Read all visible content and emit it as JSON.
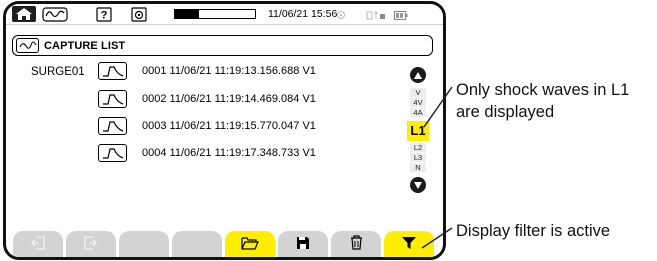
{
  "status_bar": {
    "tabs": [
      {
        "icon": "home-icon",
        "selected": true
      },
      {
        "icon": "waveform-icon",
        "selected": false
      },
      {
        "icon": "help-icon",
        "selected": false
      },
      {
        "icon": "camera-icon",
        "selected": false
      }
    ],
    "storage_fill": 0.3,
    "datetime": "11/06/21 15:56",
    "indicators": [
      "sync-icon",
      "network-icon",
      "battery-icon"
    ]
  },
  "title": {
    "icon": "waveform-icon",
    "text": "CAPTURE LIST"
  },
  "capture_list": {
    "group_label": "SURGE01",
    "rows": [
      {
        "icon": "shock-wave-icon",
        "text": "0001  11/06/21  11:19:13.156.688  V1"
      },
      {
        "icon": "shock-wave-icon",
        "text": "0002  11/06/21  11:19:14.469.084  V1"
      },
      {
        "icon": "shock-wave-icon",
        "text": "0003  11/06/21  11:19:15.770.047  V1"
      },
      {
        "icon": "shock-wave-icon",
        "text": "0004  11/06/21  11:19:17.348.733  V1"
      }
    ]
  },
  "phase_selector": {
    "up_icon": "arrow-up-icon",
    "down_icon": "arrow-down-icon",
    "upper_phases": [
      "V",
      "4V",
      "4A"
    ],
    "selected": "L1",
    "lower_phases": [
      "L2",
      "L3",
      "N"
    ]
  },
  "bottom_bar": {
    "buttons": [
      {
        "icon": "previous-icon",
        "state": "disabled"
      },
      {
        "icon": "next-icon",
        "state": "disabled"
      },
      {
        "icon": "",
        "state": "empty"
      },
      {
        "icon": "",
        "state": "empty"
      },
      {
        "icon": "open-folder-icon",
        "state": "highlighted"
      },
      {
        "icon": "save-icon",
        "state": "normal"
      },
      {
        "icon": "trash-icon",
        "state": "normal"
      },
      {
        "icon": "filter-icon",
        "state": "active"
      }
    ]
  },
  "annotations": {
    "phase_note": "Only shock waves in L1 are displayed",
    "filter_note": "Display filter is active"
  },
  "colors": {
    "highlight": "#ffee00",
    "button_gray": "#d3d3d3",
    "dark": "#1a1a1a"
  }
}
